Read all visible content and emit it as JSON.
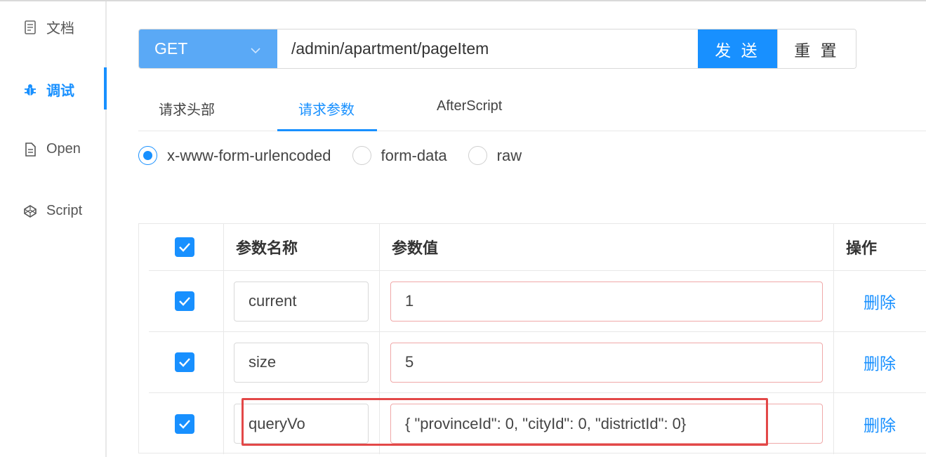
{
  "sidebar": {
    "items": [
      {
        "label": "文档",
        "icon": "document-icon"
      },
      {
        "label": "调试",
        "icon": "bug-icon"
      },
      {
        "label": "Open",
        "icon": "file-icon"
      },
      {
        "label": "Script",
        "icon": "codepen-icon"
      }
    ]
  },
  "request": {
    "method": "GET",
    "url": "/admin/apartment/pageItem",
    "send_label": "发 送",
    "reset_label": "重 置"
  },
  "tabs": [
    "请求头部",
    "请求参数",
    "AfterScript"
  ],
  "body_types": [
    "x-www-form-urlencoded",
    "form-data",
    "raw"
  ],
  "table": {
    "headers": {
      "name": "参数名称",
      "value": "参数值",
      "action": "操作"
    },
    "rows": [
      {
        "name": "current",
        "value": "1",
        "action": "删除"
      },
      {
        "name": "size",
        "value": "5",
        "action": "删除"
      },
      {
        "name": "queryVo",
        "value": "{  \"provinceId\": 0,  \"cityId\": 0,  \"districtId\": 0}",
        "action": "删除"
      }
    ]
  },
  "colors": {
    "accent": "#1890ff",
    "highlight": "#e34848"
  }
}
